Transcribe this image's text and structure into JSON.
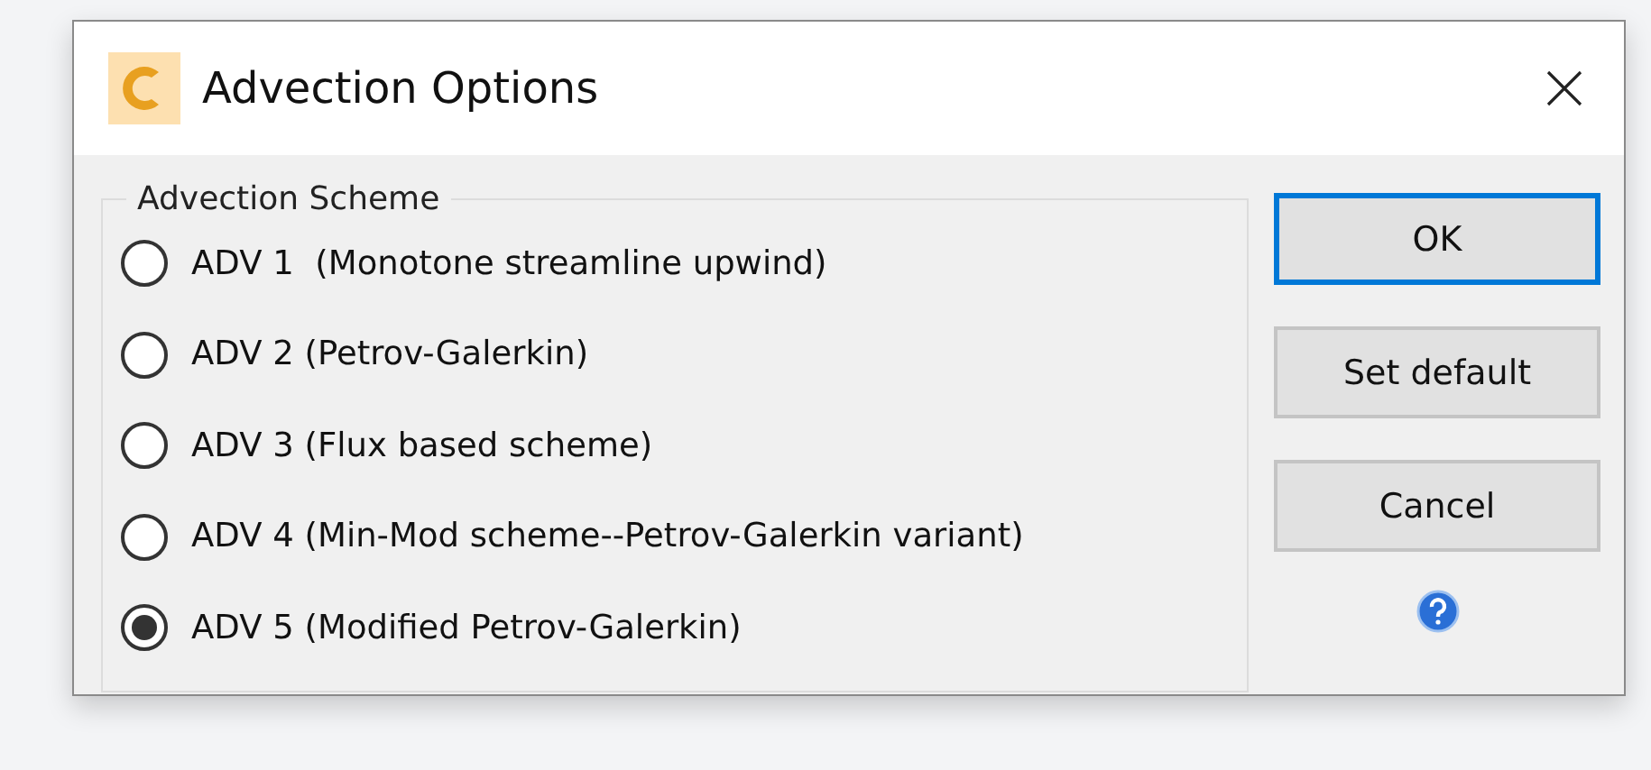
{
  "window": {
    "title": "Advection Options"
  },
  "group": {
    "title": "Advection Scheme",
    "options": [
      {
        "label": "ADV 1  (Monotone streamline upwind)",
        "selected": false
      },
      {
        "label": "ADV 2 (Petrov-Galerkin)",
        "selected": false
      },
      {
        "label": "ADV 3 (Flux based scheme)",
        "selected": false
      },
      {
        "label": "ADV 4 (Min-Mod scheme--Petrov-Galerkin variant)",
        "selected": false
      },
      {
        "label": "ADV 5 (Modified Petrov-Galerkin)",
        "selected": true
      }
    ]
  },
  "buttons": [
    {
      "label": "OK",
      "focused": true
    },
    {
      "label": "Set default",
      "focused": false
    },
    {
      "label": "Cancel",
      "focused": false
    }
  ]
}
